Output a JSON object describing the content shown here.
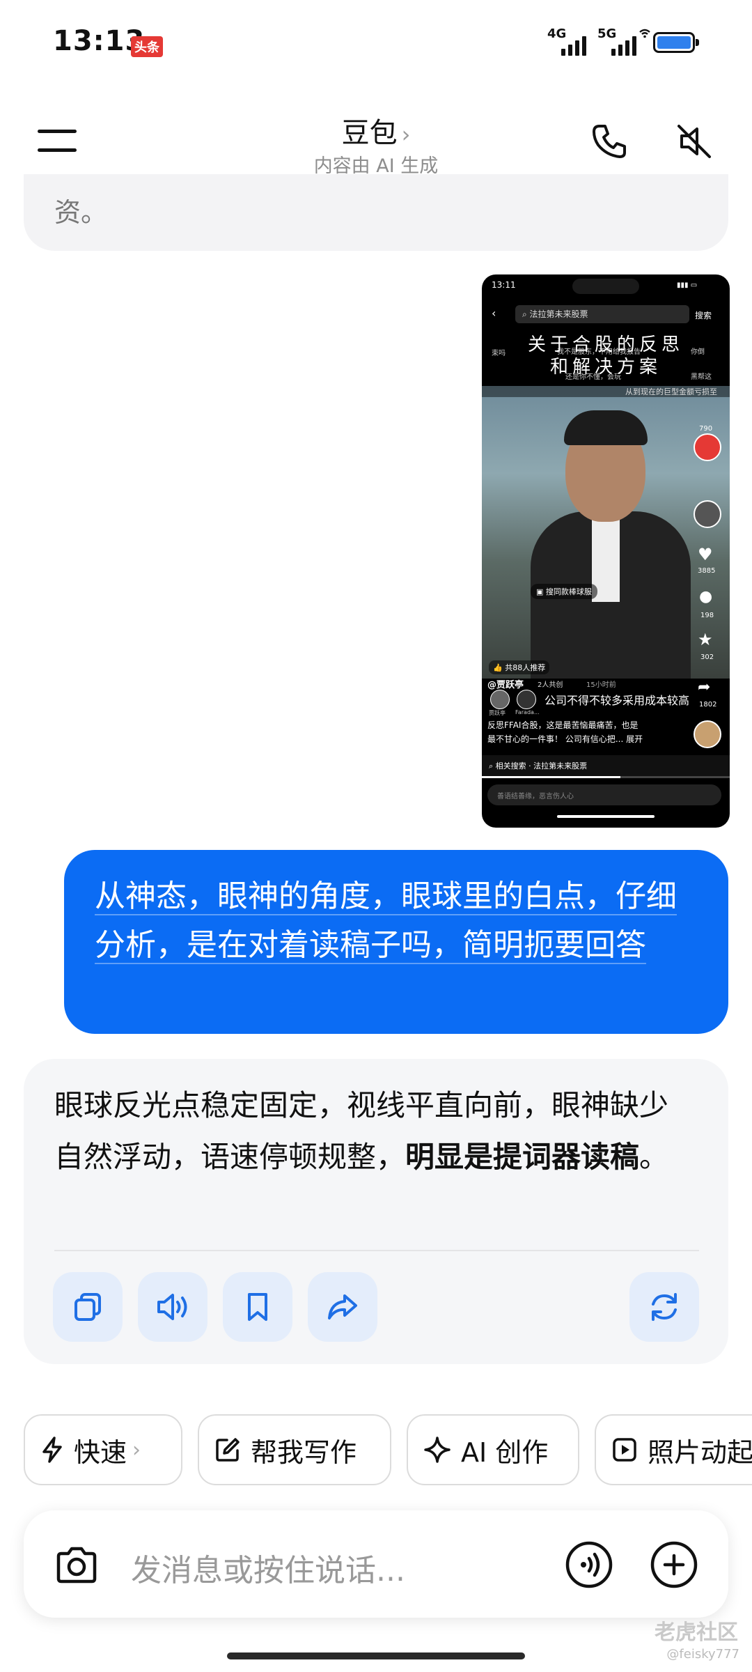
{
  "status_bar": {
    "time": "13:13",
    "badge": "头条",
    "signal1_label": "4G",
    "signal2_label": "5G"
  },
  "header": {
    "title": "豆包",
    "title_chevron": "›",
    "subtitle": "内容由 AI 生成"
  },
  "conversation": {
    "previous_ai_tail": "资。",
    "user_message": "从神态，眼神的角度，眼球里的白点，仔细分析，是在对着读稿子吗，简明扼要回答",
    "ai_reply": {
      "text_plain": "眼球反光点稳定固定，视线平直向前，眼神缺少自然浮动，语速停顿规整，",
      "text_bold": "明显是提词器读稿",
      "text_end": "。"
    }
  },
  "screenshot": {
    "time": "13:11",
    "search_query": "法拉第未来股票",
    "search_button": "搜索",
    "overlay_title_line1": "关于合股的反思",
    "overlay_title_line2": "和解决方案",
    "overlay_small_1": "我不是股东，不用给我报告",
    "overlay_small_2": "还是你不懂，会玩",
    "overlay_small_3": "你倒",
    "overlay_small_4": "黑帮这",
    "overlay_small_5": "束吗",
    "overlay_subtitle": "从到现在的巨型金额亏损至",
    "product_tag": "搜同款棒球服",
    "likes": "3885",
    "comments": "198",
    "favorites": "302",
    "shares": "1802",
    "gift_count": "790",
    "recommend": "共88人推荐",
    "author": "@贾跃亭",
    "coauthor": "2人共创",
    "time_ago": "15小时前",
    "caption_sub": "公司不得不较多采用成本较高",
    "desc_line1": "反思FFAI合股，这是最苦恼最痛苦，也是",
    "desc_line2": "最不甘心的一件事！ 公司有信心把...  展开",
    "related_search": "相关搜索 · 法拉第未来股票",
    "comment_placeholder": "善语结善缘，恶言伤人心",
    "avatar_name_1": "贾跃亭",
    "avatar_name_2": "Farada..."
  },
  "actions": [
    {
      "icon": "copy-icon"
    },
    {
      "icon": "speaker-icon"
    },
    {
      "icon": "bookmark-icon"
    },
    {
      "icon": "share-icon"
    },
    {
      "icon": "regenerate-icon"
    }
  ],
  "chips": [
    {
      "label": "快速",
      "icon": "lightning-icon",
      "chevron": "›"
    },
    {
      "label": "帮我写作",
      "icon": "edit-icon"
    },
    {
      "label": "AI 创作",
      "icon": "sparkle-icon"
    },
    {
      "label": "照片动起",
      "icon": "play-icon"
    }
  ],
  "input": {
    "placeholder": "发消息或按住说话..."
  },
  "watermark": {
    "brand": "老虎社区",
    "user": "@feisky777"
  },
  "colors": {
    "accent": "#0b6cf4",
    "bubble_gray": "#f5f6f8",
    "action_bg": "#e4edfb",
    "icon_blue": "#1f6fe5"
  }
}
